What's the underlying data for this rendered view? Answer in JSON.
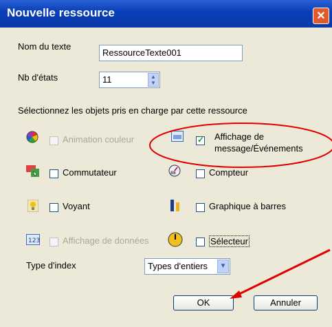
{
  "window": {
    "title": "Nouvelle ressource",
    "close_label": "✕"
  },
  "form": {
    "nom_label": "Nom du texte",
    "nom_value": "RessourceTexte001",
    "nb_label": "Nb d'états",
    "nb_value": "11",
    "select_label": "Sélectionnez les objets pris en charge par cette ressource"
  },
  "objects": [
    {
      "label": "Animation couleur",
      "checked": false,
      "enabled": false
    },
    {
      "label_line1": "Affichage de",
      "label_line2": "message/Événements",
      "checked": true,
      "enabled": true
    },
    {
      "label": "Commutateur",
      "checked": false,
      "enabled": true
    },
    {
      "label": "Compteur",
      "checked": false,
      "enabled": true
    },
    {
      "label": "Voyant",
      "checked": false,
      "enabled": true
    },
    {
      "label": "Graphique à barres",
      "checked": false,
      "enabled": true
    },
    {
      "label": "Affichage de données",
      "checked": false,
      "enabled": false
    },
    {
      "label": "Sélecteur",
      "checked": false,
      "enabled": true
    }
  ],
  "index": {
    "label": "Type d'index",
    "value": "Types d'entiers"
  },
  "buttons": {
    "ok": "OK",
    "cancel": "Annuler"
  },
  "icons": {
    "spin_up": "▲",
    "spin_down": "▼",
    "dropdown": "▼",
    "check": "✓"
  },
  "annotation": {
    "color": "#e00000"
  }
}
